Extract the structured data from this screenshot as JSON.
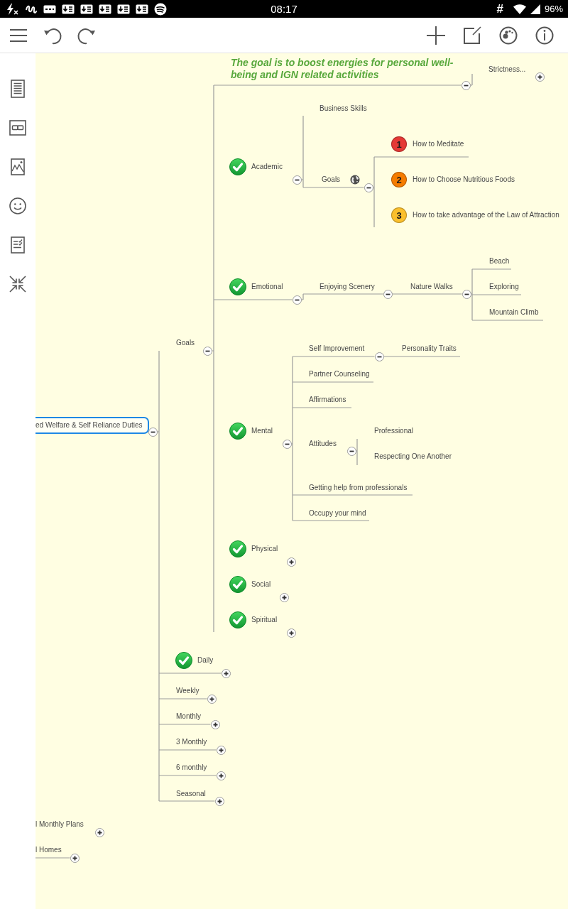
{
  "status_bar": {
    "time": "08:17",
    "indicator": "#",
    "battery": "96%"
  },
  "mind_map": {
    "nodes": [
      {
        "text": "ed Welfare & Self Reliance Duties",
        "selected": true,
        "expanded": true,
        "children": [
          {
            "text": "Goals",
            "selected": false,
            "done": false,
            "expanded": true,
            "children": [
              {
                "kind": "callout",
                "text": "The goal is to boost energies for personal well-being and IGN related activities",
                "selected": false,
                "done": false,
                "expanded": true,
                "children": [
                  {
                    "text": "Strictness...",
                    "selected": false,
                    "expanded": false
                  }
                ]
              },
              {
                "kind": "topic",
                "text": "Academic",
                "selected": false,
                "done": true,
                "expanded": true,
                "children": [
                  {
                    "text": "Business Skills",
                    "selected": false
                  },
                  {
                    "text": "Goals",
                    "selected": false,
                    "has_link": true,
                    "expanded": true,
                    "children": [
                      {
                        "text": "How to Meditate",
                        "selected": false,
                        "priority": "1",
                        "color": "#e53935"
                      },
                      {
                        "text": "How to Choose Nutritious Foods",
                        "selected": false,
                        "priority": "2",
                        "color": "#f57c00"
                      },
                      {
                        "text": "How to take advantage of the Law of Attraction",
                        "selected": false,
                        "priority": "3",
                        "color": "#fbc02d"
                      }
                    ]
                  }
                ]
              },
              {
                "kind": "topic",
                "text": "Emotional",
                "selected": false,
                "done": true,
                "expanded": true,
                "children": [
                  {
                    "text": "Enjoying Scenery",
                    "selected": false,
                    "expanded": true,
                    "children": [
                      {
                        "text": "Nature Walks",
                        "selected": false,
                        "expanded": true,
                        "children": [
                          {
                            "text": "Beach",
                            "selected": false
                          },
                          {
                            "text": "Exploring",
                            "selected": false
                          },
                          {
                            "text": "Mountain Climb",
                            "selected": false
                          }
                        ]
                      }
                    ]
                  }
                ]
              },
              {
                "kind": "topic",
                "text": "Mental",
                "selected": false,
                "done": true,
                "expanded": true,
                "children": [
                  {
                    "text": "Self Improvement",
                    "selected": false,
                    "expanded": true,
                    "children": [
                      {
                        "text": "Personality Traits",
                        "selected": false
                      }
                    ]
                  },
                  {
                    "text": "Partner Counseling",
                    "selected": false
                  },
                  {
                    "text": "Affirmations",
                    "selected": false
                  },
                  {
                    "text": "Attitudes",
                    "selected": false,
                    "expanded": true,
                    "children": [
                      {
                        "text": "Professional",
                        "selected": false
                      },
                      {
                        "text": "Respecting One Another",
                        "selected": false
                      }
                    ]
                  },
                  {
                    "text": "Getting help from professionals",
                    "selected": false
                  },
                  {
                    "text": "Occupy your mind",
                    "selected": false
                  }
                ]
              },
              {
                "kind": "topic",
                "text": "Physical",
                "selected": false,
                "done": true,
                "expanded": false
              },
              {
                "kind": "topic",
                "text": "Social",
                "selected": false,
                "done": true,
                "expanded": false
              },
              {
                "kind": "topic",
                "text": "Spiritual",
                "selected": false,
                "done": true,
                "expanded": false
              }
            ]
          },
          {
            "text": "Daily",
            "selected": false,
            "done": true,
            "expanded": false
          },
          {
            "text": "Weekly",
            "selected": false,
            "done": false,
            "expanded": false
          },
          {
            "text": "Monthly",
            "selected": false,
            "done": false,
            "expanded": false
          },
          {
            "text": "3 Monthly",
            "selected": false,
            "done": false,
            "expanded": false
          },
          {
            "text": "6 monthly",
            "selected": false,
            "done": false,
            "expanded": false
          },
          {
            "text": "Seasonal",
            "selected": false,
            "done": false,
            "expanded": false
          }
        ]
      },
      {
        "text": "l Monthly Plans",
        "selected": false,
        "expanded": false
      },
      {
        "text": "l Homes",
        "selected": false,
        "expanded": false
      }
    ]
  }
}
